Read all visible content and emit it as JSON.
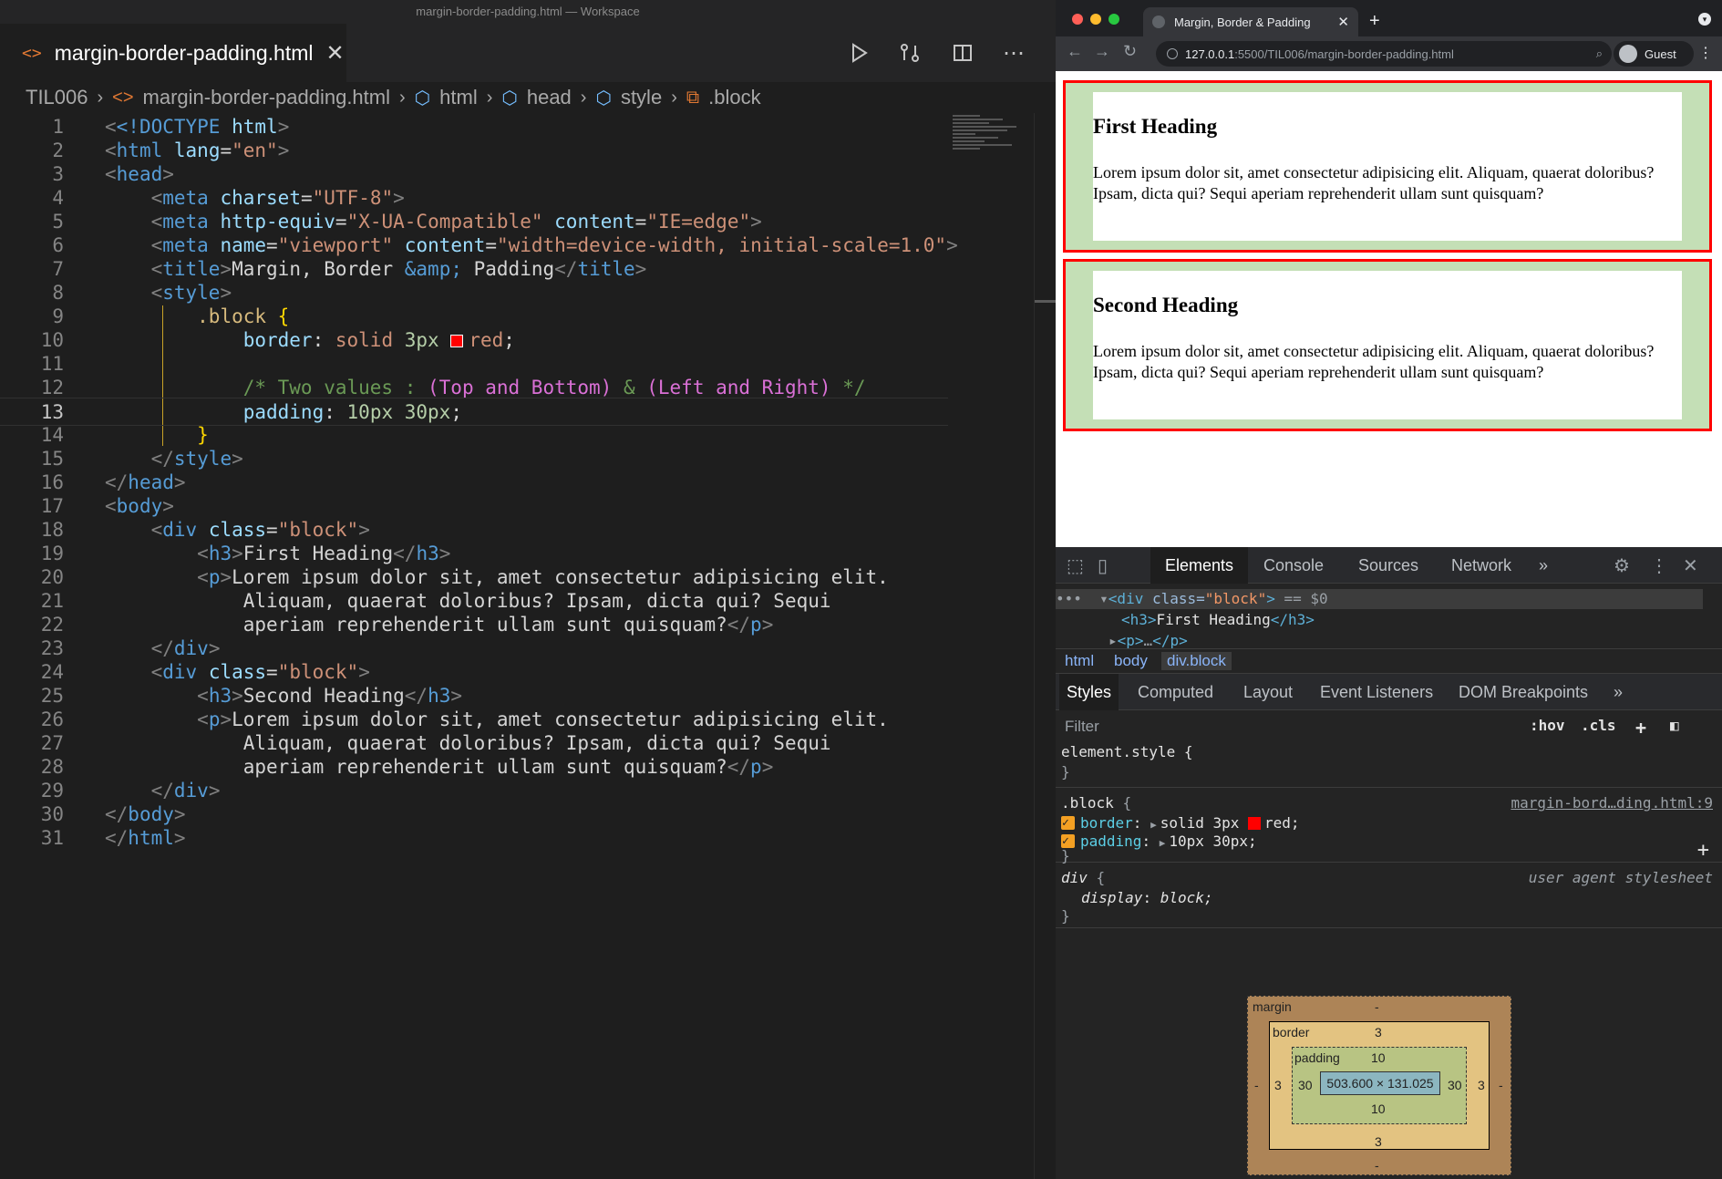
{
  "vscode": {
    "window_title": "margin-border-padding.html — Workspace",
    "tab": {
      "label": "margin-border-padding.html"
    },
    "breadcrumb": [
      "TIL006",
      "margin-border-padding.html",
      "html",
      "head",
      "style",
      ".block"
    ],
    "line_numbers": [
      "1",
      "2",
      "3",
      "4",
      "5",
      "6",
      "7",
      "8",
      "9",
      "10",
      "11",
      "12",
      "13",
      "14",
      "15",
      "16",
      "17",
      "18",
      "19",
      "20",
      "21",
      "22",
      "23",
      "24",
      "25",
      "26",
      "27",
      "28",
      "29",
      "30",
      "31"
    ],
    "current_line": 13,
    "code": {
      "l1_doctype": "<!DOCTYPE",
      "l1_html": "html",
      "l2_lang_val": "\"en\"",
      "l4_charset_val": "\"UTF-8\"",
      "l5_equiv_val": "\"X-UA-Compatible\"",
      "l5_content_val": "\"IE=edge\"",
      "l6_name_val": "\"viewport\"",
      "l6_content_val": "\"width=device-width, initial-scale=1.0\"",
      "l7_title_a": "Margin, Border ",
      "l7_amp": "&amp;",
      "l7_title_b": " Padding",
      "l9_selector": ".block",
      "l10_prop": "border",
      "l10_val_a": "solid",
      "l10_val_b": "3px",
      "l10_val_c": "red",
      "l12_comment_a": "/* Two values : ",
      "l12_comment_b": "(Top and Bottom)",
      "l12_comment_c": " & ",
      "l12_comment_d": "(Left and Right)",
      "l12_comment_e": " */",
      "l13_prop": "padding",
      "l13_val": "10px 30px",
      "class_val": "\"block\"",
      "h3_first": "First Heading",
      "h3_second": "Second Heading",
      "p_line1": "Lorem ipsum dolor sit, amet consectetur adipisicing elit.",
      "p_line2": "Aliquam, quaerat doloribus? Ipsam, dicta qui? Sequi",
      "p_line3": "aperiam reprehenderit ullam sunt quisquam?"
    }
  },
  "browser": {
    "tab_title": "Margin, Border & Padding",
    "url_host": "127.0.0.1",
    "url_rest": ":5500/TIL006/margin-border-padding.html",
    "profile": "Guest",
    "blocks": [
      {
        "heading": "First Heading",
        "text": "Lorem ipsum dolor sit, amet consectetur adipisicing elit. Aliquam, quaerat doloribus? Ipsam, dicta qui? Sequi aperiam reprehenderit ullam sunt quisquam?"
      },
      {
        "heading": "Second Heading",
        "text": "Lorem ipsum dolor sit, amet consectetur adipisicing elit. Aliquam, quaerat doloribus? Ipsam, dicta qui? Sequi aperiam reprehenderit ullam sunt quisquam?"
      }
    ]
  },
  "devtools": {
    "tabs": [
      "Elements",
      "Console",
      "Sources",
      "Network"
    ],
    "active_tab": "Elements",
    "dom_selected_open": "<div",
    "dom_selected_class": "class=",
    "dom_selected_val": "\"block\"",
    "dom_selected_suffix": " == $0",
    "dom_child_h3": "First Heading",
    "dom_crumbs": [
      "html",
      "body",
      "div.block"
    ],
    "style_tabs": [
      "Styles",
      "Computed",
      "Layout",
      "Event Listeners",
      "DOM Breakpoints"
    ],
    "filter_placeholder": "Filter",
    "hov": ":hov",
    "cls": ".cls",
    "element_style": "element.style {",
    "rule_selector": ".block",
    "rule_source": "margin-bord…ding.html:9",
    "rule_border_prop": "border",
    "rule_border_val_a": "solid 3px",
    "rule_border_val_b": "red;",
    "rule_padding_prop": "padding",
    "rule_padding_val": "10px 30px;",
    "ua_selector": "div",
    "ua_label": "user agent stylesheet",
    "ua_prop": "display",
    "ua_val": "block;",
    "boxmodel": {
      "margin_label": "margin",
      "margin_top": "-",
      "margin_bottom": "-",
      "margin_left": "-",
      "margin_right": "-",
      "border_label": "border",
      "border_top": "3",
      "border_bottom": "3",
      "border_left": "3",
      "border_right": "3",
      "padding_label": "padding",
      "padding_top": "10",
      "padding_bottom": "10",
      "padding_left": "30",
      "padding_right": "30",
      "content": "503.600 × 131.025"
    }
  },
  "colors": {
    "border_red": "#ff0000",
    "block_green": "#c4dfb6",
    "accent_orange": "#f4a023"
  }
}
